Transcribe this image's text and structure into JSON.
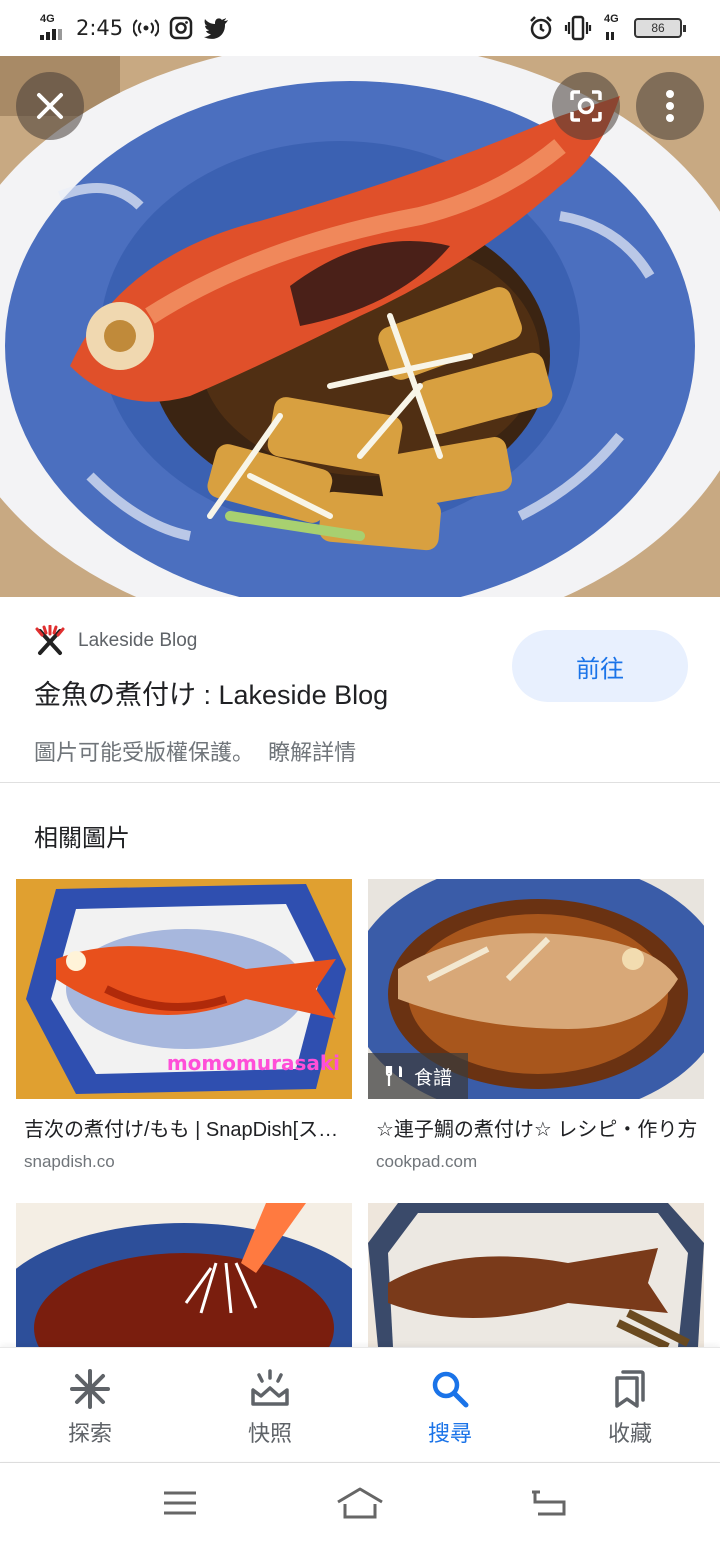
{
  "status_bar": {
    "network_left": "4G",
    "time": "2:45",
    "network_right": "4G",
    "battery": "86",
    "icons": [
      "signal-icon",
      "hotspot-icon",
      "instagram-icon",
      "twitter-icon",
      "alarm-icon",
      "vibrate-icon",
      "battery-icon"
    ]
  },
  "hero": {
    "buttons": {
      "close": "close-icon",
      "lens": "lens-icon",
      "more": "more-vert-icon"
    }
  },
  "result": {
    "site_name": "Lakeside Blog",
    "title": "金魚の煮付け : Lakeside Blog",
    "visit_label": "前往",
    "copyright_text": "圖片可能受版權保護。",
    "learn_more": "瞭解詳情"
  },
  "related": {
    "heading": "相關圖片",
    "items": [
      {
        "caption": "吉次の煮付け/もも | SnapDish[スナップディッシュ]",
        "source": "snapdish.co",
        "watermark": "momomurasaki"
      },
      {
        "caption": "☆連子鯛の煮付け☆ レシピ・作り方",
        "source": "cookpad.com",
        "badge": "食譜"
      },
      {
        "caption": "",
        "source": ""
      },
      {
        "caption": "",
        "source": ""
      }
    ]
  },
  "bottom_nav": {
    "items": [
      {
        "label": "探索",
        "icon": "asterisk-icon"
      },
      {
        "label": "快照",
        "icon": "snapshot-icon"
      },
      {
        "label": "搜尋",
        "icon": "search-icon",
        "active": true
      },
      {
        "label": "收藏",
        "icon": "bookmarks-icon"
      }
    ]
  },
  "colors": {
    "accent": "#1a73e8",
    "visit_bg": "#e8f0fe",
    "text_secondary": "#5f6368"
  }
}
